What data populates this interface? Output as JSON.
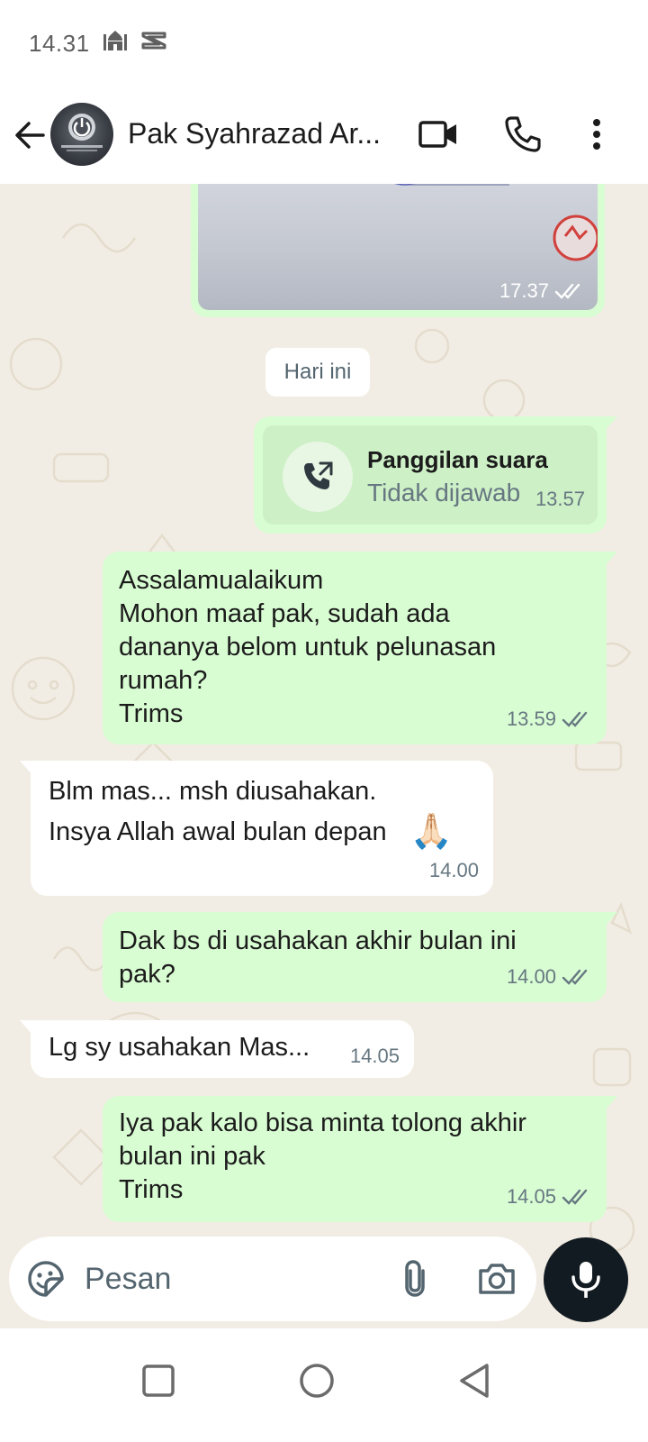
{
  "status_bar": {
    "time": "14.31",
    "icons": [
      "mosque-icon",
      "capcut-icon"
    ]
  },
  "header": {
    "contact_name": "Pak Syahrazad Ar...",
    "avatar_icon": "power-logo-avatar",
    "actions": [
      "video-call-icon",
      "voice-call-icon",
      "more-options-icon"
    ]
  },
  "chat": {
    "image_message": {
      "time": "17.37",
      "status": "read"
    },
    "date_chip": "Hari ini",
    "call_message": {
      "title": "Panggilan suara",
      "subtitle": "Tidak dijawab",
      "time": "13.57"
    },
    "messages": [
      {
        "direction": "outgoing",
        "text": "Assalamualaikum\nMohon maaf pak, sudah ada\ndananya belom untuk pelunasan\nrumah?\nTrims",
        "time": "13.59",
        "status": "read"
      },
      {
        "direction": "incoming",
        "line1": "Blm mas... msh diusahakan.",
        "line2": "Insya Allah awal bulan depan",
        "emoji": "🙏🏻",
        "time": "14.00"
      },
      {
        "direction": "outgoing",
        "text": "Dak bs di usahakan akhir bulan ini\npak?",
        "time": "14.00",
        "status": "read"
      },
      {
        "direction": "incoming",
        "text": "Lg sy usahakan Mas...",
        "time": "14.05"
      },
      {
        "direction": "outgoing",
        "text": "Iya pak kalo bisa minta tolong akhir\nbulan ini pak\nTrims",
        "time": "14.05",
        "status": "read"
      }
    ]
  },
  "composer": {
    "placeholder": "Pesan",
    "icons": [
      "sticker-icon",
      "attach-icon",
      "camera-icon",
      "mic-icon"
    ]
  },
  "nav_bar": {
    "icons": [
      "recents-icon",
      "home-icon",
      "back-nav-icon"
    ]
  },
  "colors": {
    "outgoing_bubble": "#d9fdd3",
    "incoming_bubble": "#ffffff",
    "chat_background": "#f2ede4",
    "mic_button": "#111b21",
    "meta_text": "#667781"
  }
}
